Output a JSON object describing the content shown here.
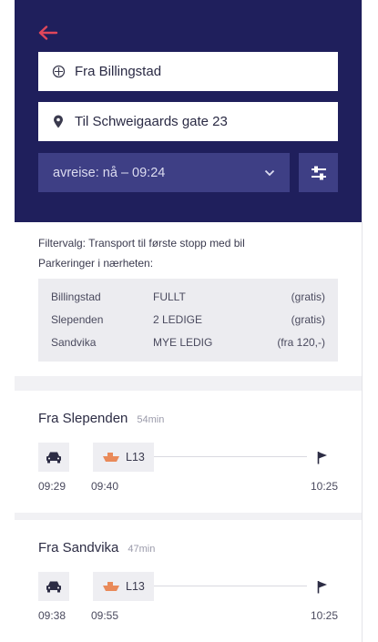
{
  "search": {
    "from": "Fra Billingstad",
    "to": "Til Schweigaards gate 23",
    "departure": "avreise: nå – 09:24"
  },
  "info": {
    "filter_text": "Filtervalg: Transport til første stopp med bil",
    "parking_heading": "Parkeringer i nærheten:",
    "parking": [
      {
        "place": "Billingstad",
        "status": "FULLT",
        "price": "(gratis)"
      },
      {
        "place": "Slependen",
        "status": "2 LEDIGE",
        "price": "(gratis)"
      },
      {
        "place": "Sandvika",
        "status": "MYE LEDIG",
        "price": "(fra 120,-)"
      }
    ]
  },
  "trips": [
    {
      "title": "Fra Slependen",
      "duration": "54min",
      "line": "L13",
      "car_time": "09:29",
      "boat_time": "09:40",
      "arrival": "10:25"
    },
    {
      "title": "Fra Sandvika",
      "duration": "47min",
      "line": "L13",
      "car_time": "09:38",
      "boat_time": "09:55",
      "arrival": "10:25"
    }
  ],
  "colors": {
    "header_bg": "#1f1f5c",
    "control_bg": "#3e3f85",
    "accent_red": "#e0475a",
    "boat_orange": "#e98a5a"
  },
  "icons": {
    "back": "arrow-left-icon",
    "from": "crosshair-icon",
    "to": "location-pin-icon",
    "dropdown": "chevron-down-icon",
    "filter": "filter-sliders-icon",
    "car": "car-icon",
    "boat": "boat-icon",
    "arrival": "flag-icon"
  }
}
